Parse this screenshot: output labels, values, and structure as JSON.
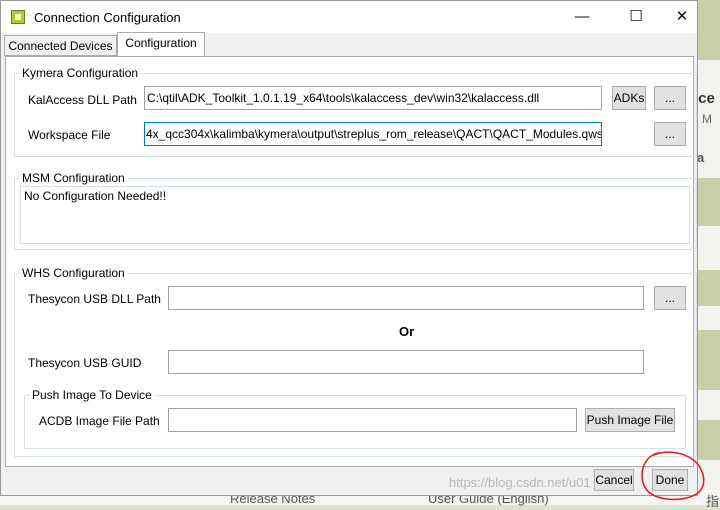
{
  "window": {
    "title": "Connection Configuration",
    "minimize": "—",
    "maximize": "☐",
    "close": "✕"
  },
  "tabs": [
    {
      "label": "Connected Devices",
      "active": false
    },
    {
      "label": "Configuration",
      "active": true
    }
  ],
  "kymera": {
    "group_label": "Kymera Configuration",
    "kalaccess_label": "KalAccess DLL Path",
    "kalaccess_value": "C:\\qtil\\ADK_Toolkit_1.0.1.19_x64\\tools\\kalaccess_dev\\win32\\kalaccess.dll",
    "adks_button": "ADKs",
    "browse_button": "...",
    "workspace_label": "Workspace File",
    "workspace_value": "4x_qcc304x\\kalimba\\kymera\\output\\streplus_rom_release\\QACT\\QACT_Modules.qwsp"
  },
  "msm": {
    "group_label": "MSM Configuration",
    "message": "No Configuration Needed!!"
  },
  "whs": {
    "group_label": "WHS Configuration",
    "dll_label": "Thesycon USB DLL Path",
    "dll_value": "",
    "browse_button": "...",
    "or_text": "Or",
    "guid_label": "Thesycon USB GUID",
    "guid_value": ""
  },
  "push": {
    "group_label": "Push Image To Device",
    "acdb_label": "ACDB Image File Path",
    "acdb_value": "",
    "push_button": "Push Image File"
  },
  "footer": {
    "cancel_button": "Cancel",
    "done_button": "Done",
    "watermark": "https://blog.csdn.net/u01"
  },
  "background": {
    "right_title": "ice",
    "right_sub": "n M",
    "right_heading": "ra",
    "bottom_left": "Release Notes",
    "bottom_mid": "User Guide (English)",
    "bottom_right": "指"
  },
  "colors": {
    "accent_blue": "#0078d7",
    "annotation_red": "#e32020",
    "app_icon_green": "#b9c63c"
  }
}
